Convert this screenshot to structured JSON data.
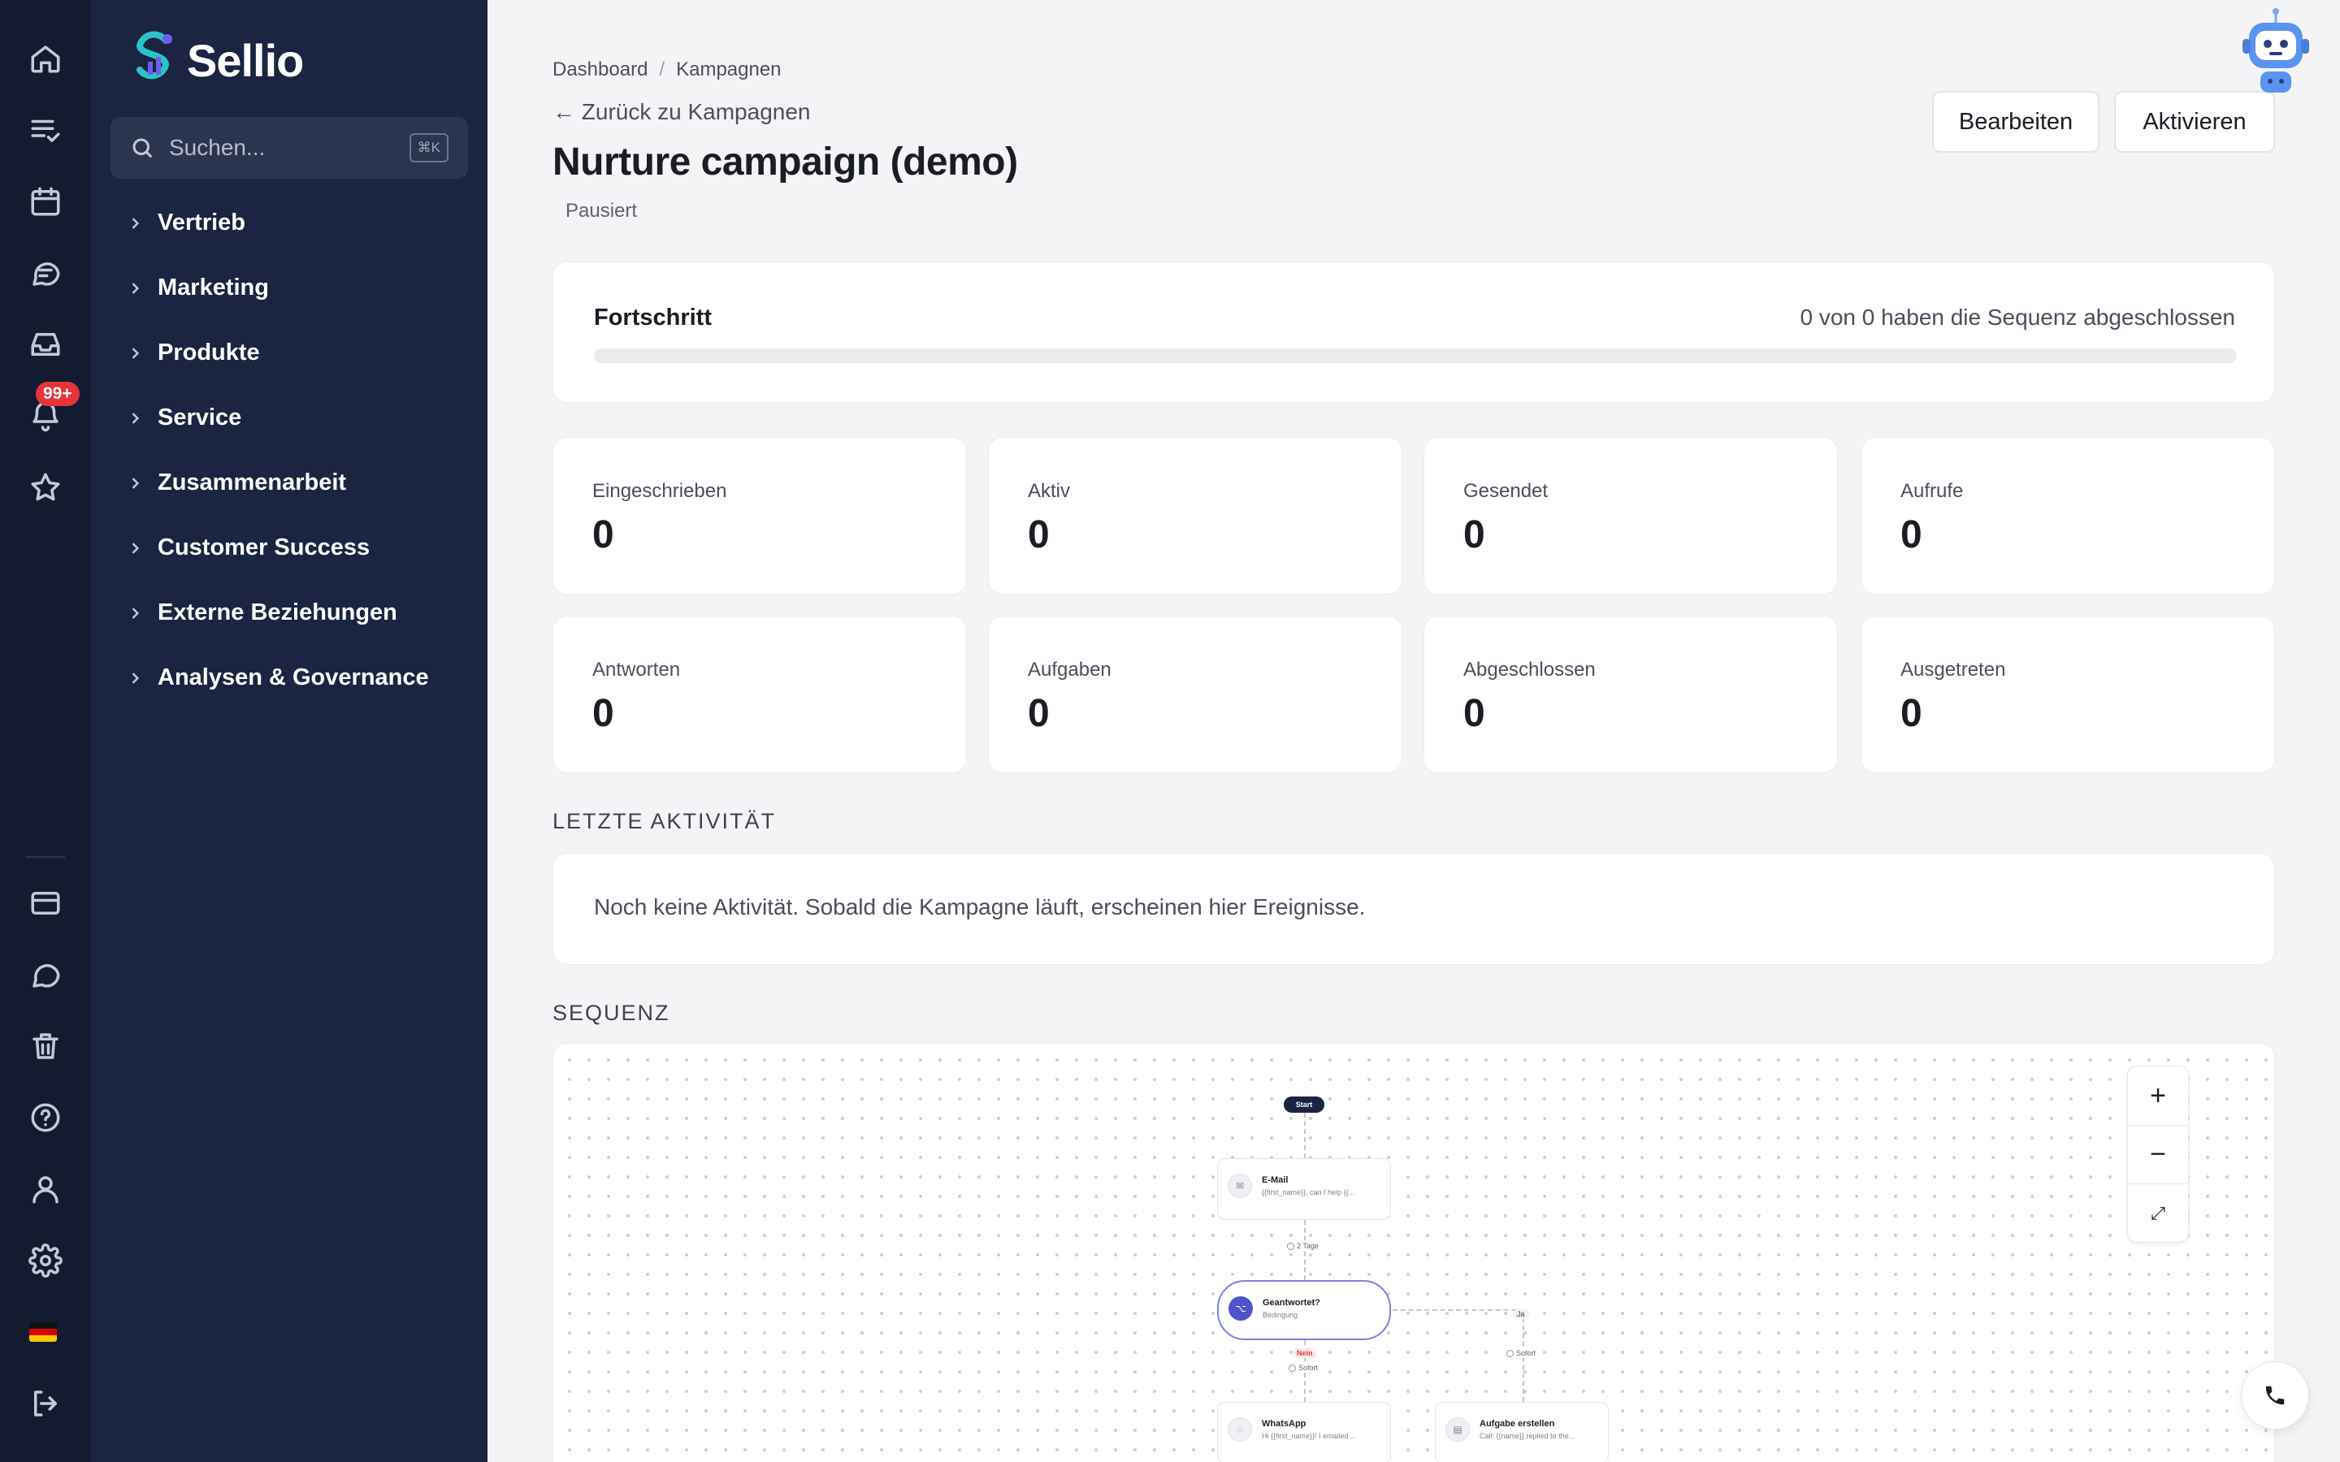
{
  "app": {
    "name": "Sellio"
  },
  "rail": {
    "notification_badge": "99+"
  },
  "sidebar": {
    "search_placeholder": "Suchen...",
    "search_shortcut": "⌘K",
    "items": [
      {
        "label": "Vertrieb"
      },
      {
        "label": "Marketing"
      },
      {
        "label": "Produkte"
      },
      {
        "label": "Service"
      },
      {
        "label": "Zusammenarbeit"
      },
      {
        "label": "Customer Success"
      },
      {
        "label": "Externe Beziehungen"
      },
      {
        "label": "Analysen & Governance"
      }
    ]
  },
  "header": {
    "breadcrumb": [
      "Dashboard",
      "Kampagnen"
    ],
    "breadcrumb_separator": "/",
    "back_link": "← Zurück zu Kampagnen",
    "title": "Nurture campaign (demo)",
    "status": "Pausiert",
    "edit_label": "Bearbeiten",
    "activate_label": "Aktivieren"
  },
  "progress": {
    "label": "Fortschritt",
    "text": "0 von 0 haben die Sequenz abgeschlossen",
    "fraction": 0
  },
  "stats": [
    {
      "label": "Eingeschrieben",
      "value": "0"
    },
    {
      "label": "Aktiv",
      "value": "0"
    },
    {
      "label": "Gesendet",
      "value": "0"
    },
    {
      "label": "Aufrufe",
      "value": "0"
    },
    {
      "label": "Antworten",
      "value": "0"
    },
    {
      "label": "Aufgaben",
      "value": "0"
    },
    {
      "label": "Abgeschlossen",
      "value": "0"
    },
    {
      "label": "Ausgetreten",
      "value": "0"
    }
  ],
  "activity": {
    "title": "LETZTE AKTIVITÄT",
    "empty_text": "Noch keine Aktivität. Sobald die Kampagne läuft, erscheinen hier Ereignisse."
  },
  "sequence": {
    "title": "SEQUENZ",
    "zoom_in": "+",
    "zoom_out": "−",
    "fit": "⤢",
    "start_label": "Start",
    "email_node": {
      "title": "E-Mail",
      "preview": "{{first_name}}, can I help {{..."
    },
    "wait_chip": "2 Tage",
    "condition_node": {
      "title": "Geantwortet?",
      "subtitle": "Bedingung"
    },
    "no_label": "Nein",
    "yes_label": "Ja",
    "no_delay": "Sofort",
    "yes_delay": "Sofort",
    "whatsapp_node": {
      "title": "WhatsApp",
      "preview": "Hi {{first_name}}! I emailed ..."
    },
    "task_node": {
      "title": "Aufgabe erstellen",
      "preview": "Call: {{name}} replied to the..."
    }
  },
  "colors": {
    "sidebar_bg": "#1b2440",
    "rail_bg": "#131b30",
    "accent": "#4f54c8",
    "badge": "#e5333a"
  },
  "icons": [
    "home-icon",
    "tasks-icon",
    "calendar-icon",
    "chat-icon",
    "inbox-icon",
    "bell-icon",
    "star-icon",
    "card-icon",
    "message-icon",
    "trash-icon",
    "help-icon",
    "user-icon",
    "settings-icon",
    "flag-de-icon",
    "logout-icon",
    "robot-icon",
    "phone-icon"
  ]
}
